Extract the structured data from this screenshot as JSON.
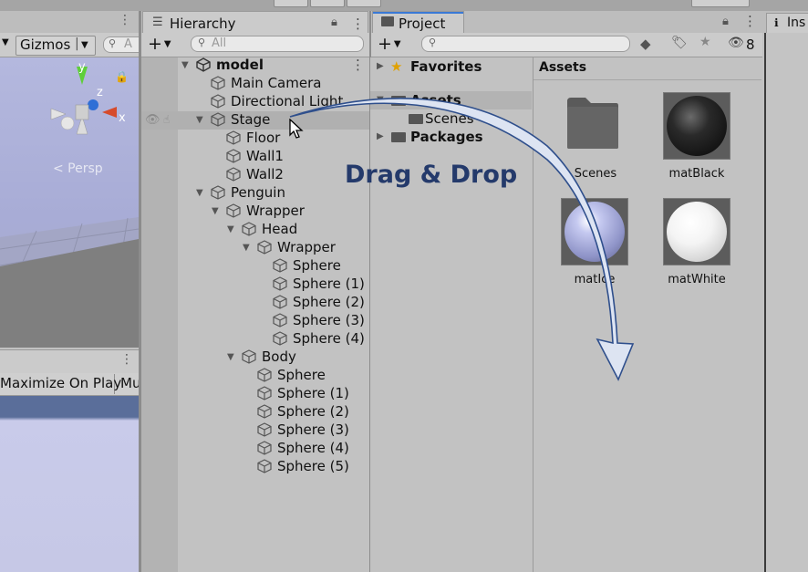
{
  "scene": {
    "gizmos_label": "Gizmos",
    "search_placeholder": "A",
    "persp_label": "< Persp",
    "axis_y": "y",
    "axis_z": "z",
    "axis_x": "x"
  },
  "game": {
    "maximize_label": "Maximize On Play",
    "mute_label": "Mu"
  },
  "hierarchy": {
    "tab_label": "Hierarchy",
    "search_placeholder": "All",
    "add_label": "+",
    "root": "model",
    "items": [
      {
        "label": "Main Camera",
        "depth": 1,
        "arrow": ""
      },
      {
        "label": "Directional Light",
        "depth": 1,
        "arrow": ""
      },
      {
        "label": "Stage",
        "depth": 1,
        "arrow": "▼"
      },
      {
        "label": "Floor",
        "depth": 2,
        "arrow": ""
      },
      {
        "label": "Wall1",
        "depth": 2,
        "arrow": ""
      },
      {
        "label": "Wall2",
        "depth": 2,
        "arrow": ""
      },
      {
        "label": "Penguin",
        "depth": 1,
        "arrow": "▼"
      },
      {
        "label": "Wrapper",
        "depth": 2,
        "arrow": "▼"
      },
      {
        "label": "Head",
        "depth": 3,
        "arrow": "▼"
      },
      {
        "label": "Wrapper",
        "depth": 4,
        "arrow": "▼"
      },
      {
        "label": "Sphere",
        "depth": 5,
        "arrow": ""
      },
      {
        "label": "Sphere (1)",
        "depth": 5,
        "arrow": ""
      },
      {
        "label": "Sphere (2)",
        "depth": 5,
        "arrow": ""
      },
      {
        "label": "Sphere (3)",
        "depth": 5,
        "arrow": ""
      },
      {
        "label": "Sphere (4)",
        "depth": 5,
        "arrow": ""
      },
      {
        "label": "Body",
        "depth": 3,
        "arrow": "▼"
      },
      {
        "label": "Sphere",
        "depth": 4,
        "arrow": ""
      },
      {
        "label": "Sphere (1)",
        "depth": 4,
        "arrow": ""
      },
      {
        "label": "Sphere (2)",
        "depth": 4,
        "arrow": ""
      },
      {
        "label": "Sphere (3)",
        "depth": 4,
        "arrow": ""
      },
      {
        "label": "Sphere (4)",
        "depth": 4,
        "arrow": ""
      },
      {
        "label": "Sphere (5)",
        "depth": 4,
        "arrow": ""
      }
    ]
  },
  "project": {
    "tab_label": "Project",
    "add_label": "+",
    "hidden_count": "8",
    "tree": {
      "favorites": "Favorites",
      "assets": "Assets",
      "scenes": "Scenes",
      "packages": "Packages"
    },
    "breadcrumb": "Assets",
    "assets": [
      {
        "name": "Scenes",
        "kind": "folder"
      },
      {
        "name": "matBlack",
        "kind": "material",
        "color": "#1e1e1e"
      },
      {
        "name": "matIce",
        "kind": "material",
        "color": "#a9aede"
      },
      {
        "name": "matWhite",
        "kind": "material",
        "color": "#f2f2f2"
      }
    ]
  },
  "inspector": {
    "tab_label": "Ins"
  },
  "annotation": {
    "text": "Drag & Drop",
    "color": "#243a6b",
    "arrow_fill": "#dfe6f3",
    "arrow_stroke": "#2f4f8c"
  },
  "colors": {
    "accent": "#3a79d6",
    "selection": "#b0b0b0"
  },
  "icons": [
    "search-icon",
    "lock-icon",
    "more-icon",
    "folder-icon",
    "star-icon",
    "tag-icon",
    "eye-icon",
    "cube-icon",
    "unity-logo-icon",
    "info-icon"
  ]
}
